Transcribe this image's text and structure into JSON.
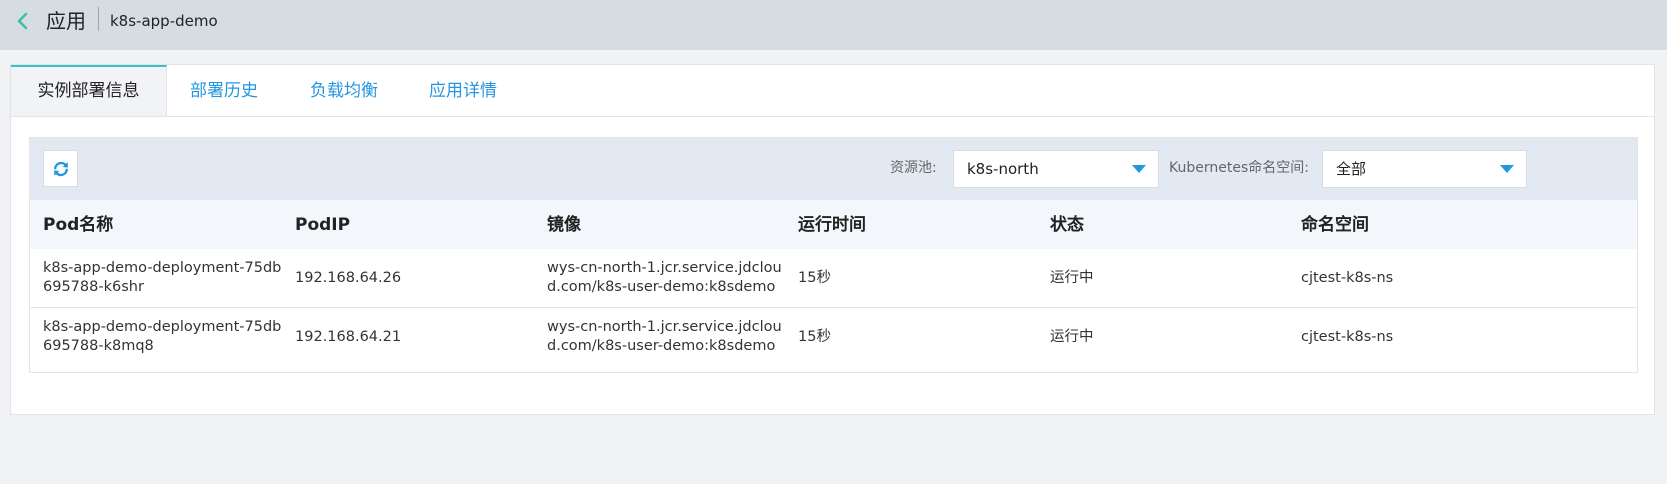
{
  "header": {
    "title": "应用",
    "app_name": "k8s-app-demo"
  },
  "tabs": [
    {
      "label": "实例部署信息",
      "active": true
    },
    {
      "label": "部署历史",
      "active": false
    },
    {
      "label": "负载均衡",
      "active": false
    },
    {
      "label": "应用详情",
      "active": false
    }
  ],
  "toolbar": {
    "refresh_icon": "refresh-icon",
    "pool_label": "资源池:",
    "pool_value": "k8s-north",
    "namespace_label": "Kubernetes命名空间:",
    "namespace_value": "全部"
  },
  "table": {
    "columns": [
      "Pod名称",
      "PodIP",
      "镜像",
      "运行时间",
      "状态",
      "命名空间"
    ],
    "rows": [
      {
        "name": "k8s-app-demo-deployment-75db695788-k6shr",
        "ip": "192.168.64.26",
        "image": "wys-cn-north-1.jcr.service.jdcloud.com/k8s-user-demo:k8sdemo",
        "uptime": "15秒",
        "status": "运行中",
        "namespace": "cjtest-k8s-ns"
      },
      {
        "name": "k8s-app-demo-deployment-75db695788-k8mq8",
        "ip": "192.168.64.21",
        "image": "wys-cn-north-1.jcr.service.jdcloud.com/k8s-user-demo:k8sdemo",
        "uptime": "15秒",
        "status": "运行中",
        "namespace": "cjtest-k8s-ns"
      }
    ]
  },
  "colors": {
    "accent_link": "#2496e0",
    "active_tab_border": "#3ec0c4",
    "back_icon": "#3ec0a0",
    "caret": "#2496e0"
  }
}
